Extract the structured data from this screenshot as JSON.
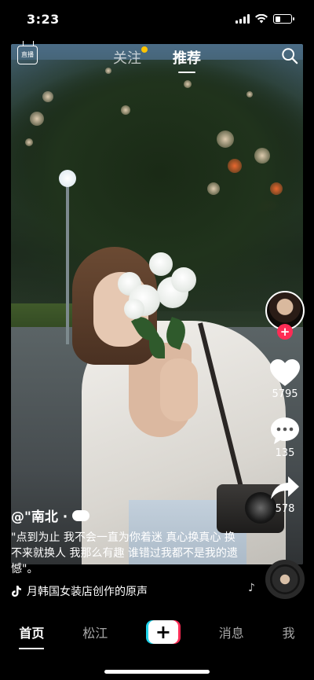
{
  "status_bar": {
    "time": "3:23",
    "battery_level": 0.35
  },
  "top_nav": {
    "live_label": "直播",
    "tabs": [
      {
        "label": "关注",
        "active": false,
        "has_dot": true
      },
      {
        "label": "推荐",
        "active": true,
        "has_dot": false
      }
    ],
    "search_icon": "search-icon"
  },
  "actions": {
    "like_count": "5795",
    "comment_count": "135",
    "share_count": "578",
    "follow_symbol": "+"
  },
  "caption": {
    "author": "@\"南北 ·",
    "description": "\"点到为止 我不会一直为你着迷 真心换真心 换不来就换人 我那么有趣 谁错过我都不是我的遗憾\"。",
    "music": "月韩国女装店创作的原声"
  },
  "bottom_nav": {
    "items": [
      {
        "label": "首页",
        "active": true
      },
      {
        "label": "松江",
        "active": false
      },
      {
        "label": "+",
        "active": false
      },
      {
        "label": "消息",
        "active": false
      },
      {
        "label": "我",
        "active": false
      }
    ]
  },
  "colors": {
    "accent": "#fe2c55",
    "cyan": "#20d5ec",
    "dot": "#ffc400"
  }
}
